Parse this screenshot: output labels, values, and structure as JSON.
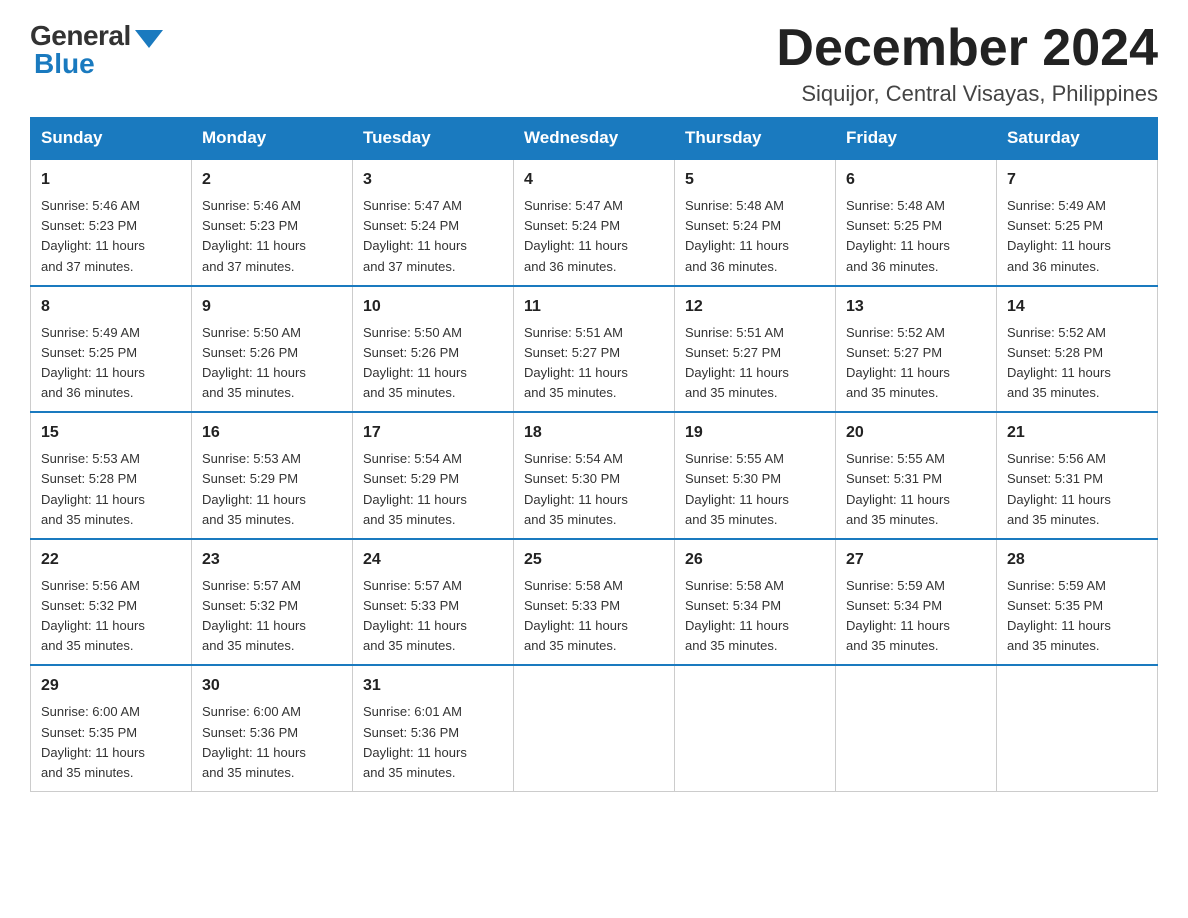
{
  "logo": {
    "general_text": "General",
    "blue_text": "Blue"
  },
  "header": {
    "month_title": "December 2024",
    "subtitle": "Siquijor, Central Visayas, Philippines"
  },
  "weekdays": [
    "Sunday",
    "Monday",
    "Tuesday",
    "Wednesday",
    "Thursday",
    "Friday",
    "Saturday"
  ],
  "weeks": [
    [
      {
        "day": "1",
        "sunrise": "5:46 AM",
        "sunset": "5:23 PM",
        "daylight": "11 hours and 37 minutes."
      },
      {
        "day": "2",
        "sunrise": "5:46 AM",
        "sunset": "5:23 PM",
        "daylight": "11 hours and 37 minutes."
      },
      {
        "day": "3",
        "sunrise": "5:47 AM",
        "sunset": "5:24 PM",
        "daylight": "11 hours and 37 minutes."
      },
      {
        "day": "4",
        "sunrise": "5:47 AM",
        "sunset": "5:24 PM",
        "daylight": "11 hours and 36 minutes."
      },
      {
        "day": "5",
        "sunrise": "5:48 AM",
        "sunset": "5:24 PM",
        "daylight": "11 hours and 36 minutes."
      },
      {
        "day": "6",
        "sunrise": "5:48 AM",
        "sunset": "5:25 PM",
        "daylight": "11 hours and 36 minutes."
      },
      {
        "day": "7",
        "sunrise": "5:49 AM",
        "sunset": "5:25 PM",
        "daylight": "11 hours and 36 minutes."
      }
    ],
    [
      {
        "day": "8",
        "sunrise": "5:49 AM",
        "sunset": "5:25 PM",
        "daylight": "11 hours and 36 minutes."
      },
      {
        "day": "9",
        "sunrise": "5:50 AM",
        "sunset": "5:26 PM",
        "daylight": "11 hours and 35 minutes."
      },
      {
        "day": "10",
        "sunrise": "5:50 AM",
        "sunset": "5:26 PM",
        "daylight": "11 hours and 35 minutes."
      },
      {
        "day": "11",
        "sunrise": "5:51 AM",
        "sunset": "5:27 PM",
        "daylight": "11 hours and 35 minutes."
      },
      {
        "day": "12",
        "sunrise": "5:51 AM",
        "sunset": "5:27 PM",
        "daylight": "11 hours and 35 minutes."
      },
      {
        "day": "13",
        "sunrise": "5:52 AM",
        "sunset": "5:27 PM",
        "daylight": "11 hours and 35 minutes."
      },
      {
        "day": "14",
        "sunrise": "5:52 AM",
        "sunset": "5:28 PM",
        "daylight": "11 hours and 35 minutes."
      }
    ],
    [
      {
        "day": "15",
        "sunrise": "5:53 AM",
        "sunset": "5:28 PM",
        "daylight": "11 hours and 35 minutes."
      },
      {
        "day": "16",
        "sunrise": "5:53 AM",
        "sunset": "5:29 PM",
        "daylight": "11 hours and 35 minutes."
      },
      {
        "day": "17",
        "sunrise": "5:54 AM",
        "sunset": "5:29 PM",
        "daylight": "11 hours and 35 minutes."
      },
      {
        "day": "18",
        "sunrise": "5:54 AM",
        "sunset": "5:30 PM",
        "daylight": "11 hours and 35 minutes."
      },
      {
        "day": "19",
        "sunrise": "5:55 AM",
        "sunset": "5:30 PM",
        "daylight": "11 hours and 35 minutes."
      },
      {
        "day": "20",
        "sunrise": "5:55 AM",
        "sunset": "5:31 PM",
        "daylight": "11 hours and 35 minutes."
      },
      {
        "day": "21",
        "sunrise": "5:56 AM",
        "sunset": "5:31 PM",
        "daylight": "11 hours and 35 minutes."
      }
    ],
    [
      {
        "day": "22",
        "sunrise": "5:56 AM",
        "sunset": "5:32 PM",
        "daylight": "11 hours and 35 minutes."
      },
      {
        "day": "23",
        "sunrise": "5:57 AM",
        "sunset": "5:32 PM",
        "daylight": "11 hours and 35 minutes."
      },
      {
        "day": "24",
        "sunrise": "5:57 AM",
        "sunset": "5:33 PM",
        "daylight": "11 hours and 35 minutes."
      },
      {
        "day": "25",
        "sunrise": "5:58 AM",
        "sunset": "5:33 PM",
        "daylight": "11 hours and 35 minutes."
      },
      {
        "day": "26",
        "sunrise": "5:58 AM",
        "sunset": "5:34 PM",
        "daylight": "11 hours and 35 minutes."
      },
      {
        "day": "27",
        "sunrise": "5:59 AM",
        "sunset": "5:34 PM",
        "daylight": "11 hours and 35 minutes."
      },
      {
        "day": "28",
        "sunrise": "5:59 AM",
        "sunset": "5:35 PM",
        "daylight": "11 hours and 35 minutes."
      }
    ],
    [
      {
        "day": "29",
        "sunrise": "6:00 AM",
        "sunset": "5:35 PM",
        "daylight": "11 hours and 35 minutes."
      },
      {
        "day": "30",
        "sunrise": "6:00 AM",
        "sunset": "5:36 PM",
        "daylight": "11 hours and 35 minutes."
      },
      {
        "day": "31",
        "sunrise": "6:01 AM",
        "sunset": "5:36 PM",
        "daylight": "11 hours and 35 minutes."
      },
      null,
      null,
      null,
      null
    ]
  ],
  "labels": {
    "sunrise": "Sunrise:",
    "sunset": "Sunset:",
    "daylight": "Daylight:"
  }
}
